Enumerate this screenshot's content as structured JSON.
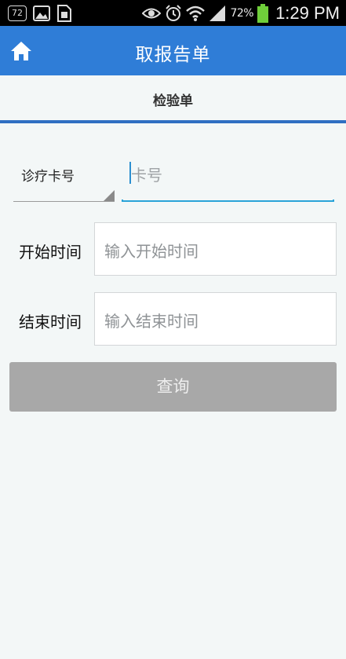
{
  "status_bar": {
    "notification_badge": "72",
    "battery_percent": "72%",
    "time": "1:29 PM",
    "icons": [
      "notification-count-icon",
      "image-icon",
      "sim-icon",
      "eye-icon",
      "alarm-icon",
      "wifi-icon",
      "signal-icon",
      "battery-icon"
    ]
  },
  "app_bar": {
    "title": "取报告单",
    "home_icon": "home-icon",
    "color": "#2f7dd7"
  },
  "tab": {
    "label": "检验单",
    "indicator_color": "#2f6fc2"
  },
  "form": {
    "card_type": {
      "selected": "诊疗卡号"
    },
    "card_number": {
      "placeholder": "卡号"
    },
    "start_time": {
      "label": "开始时间",
      "placeholder": "输入开始时间"
    },
    "end_time": {
      "label": "结束时间",
      "placeholder": "输入结束时间"
    },
    "query_button": "查询"
  }
}
